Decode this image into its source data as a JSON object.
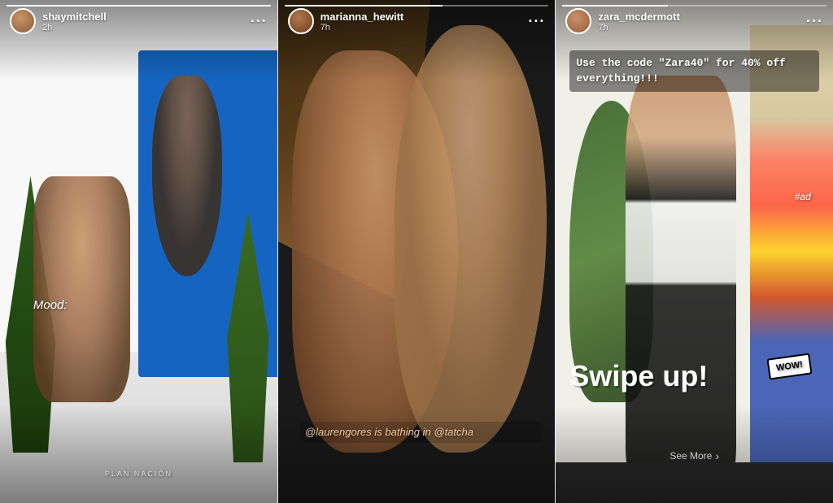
{
  "stories": [
    {
      "id": "story-1",
      "username": "shaymitchell",
      "time_ago": "2h",
      "avatar_class": "avatar-1",
      "progress": "100",
      "mood_text": "Mood:",
      "watermark_text": "PLAN NACIÓN",
      "caption": null,
      "promo": null,
      "swipe_up": null,
      "ad_tag": null,
      "wow": null,
      "see_more": null
    },
    {
      "id": "story-2",
      "username": "marianna_hewitt",
      "time_ago": "7h",
      "avatar_class": "avatar-2",
      "progress": "60",
      "mood_text": null,
      "watermark_text": null,
      "caption": "@laurengores is bathing in @tatcha",
      "promo": null,
      "swipe_up": null,
      "ad_tag": null,
      "wow": null,
      "see_more": null
    },
    {
      "id": "story-3",
      "username": "zara_mcdermott",
      "time_ago": "7h",
      "avatar_class": "avatar-3",
      "progress": "40",
      "mood_text": null,
      "watermark_text": null,
      "caption": null,
      "promo": "Use the code \"Zara40\" for\n40% off everything!!!",
      "swipe_up": "Swipe up!",
      "ad_tag": "#ad",
      "wow": "WOW!",
      "see_more": "See More"
    }
  ],
  "more_button_label": "···"
}
